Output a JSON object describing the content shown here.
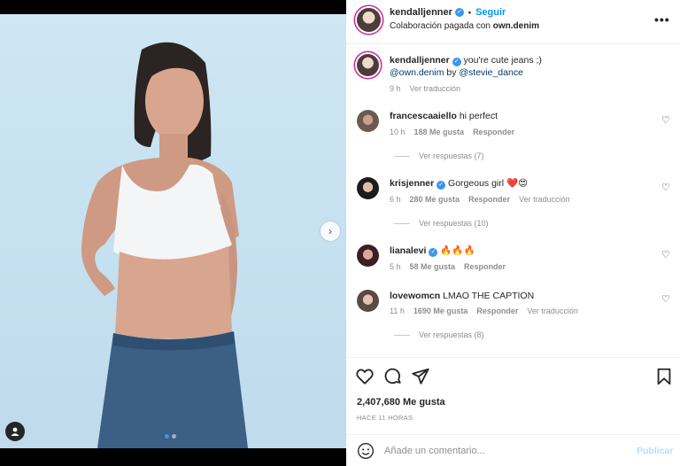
{
  "post": {
    "username": "kendalljenner",
    "follow_label": "Seguir",
    "sponsored_prefix": "Colaboración pagada con",
    "sponsor": "own.denim",
    "caption_text": "you're cute jeans ;)",
    "caption_mention1": "@own.denim",
    "caption_by": "by",
    "caption_mention2": "@stevie_dance",
    "caption_time": "9 h",
    "caption_translate": "Ver traducción",
    "likes": "2,407,680 Me gusta",
    "posted": "HACE 11 HORAS",
    "carousel_pages": 2,
    "carousel_current": 1
  },
  "comments": [
    {
      "user": "francescaaiello",
      "verified": false,
      "text": "hi perfect",
      "time": "10 h",
      "likes": "188 Me gusta",
      "reply": "Responder",
      "translate": "",
      "replies": "Ver respuestas (7)"
    },
    {
      "user": "krisjenner",
      "verified": true,
      "text": "Gorgeous girl ❤️😍",
      "time": "6 h",
      "likes": "280 Me gusta",
      "reply": "Responder",
      "translate": "Ver traducción",
      "replies": "Ver respuestas (10)"
    },
    {
      "user": "lianalevi",
      "verified": true,
      "text": "🔥🔥🔥",
      "time": "5 h",
      "likes": "58 Me gusta",
      "reply": "Responder",
      "translate": "",
      "replies": ""
    },
    {
      "user": "lovewomcn",
      "verified": false,
      "text": "LMAO THE CAPTION",
      "time": "11 h",
      "likes": "1690 Me gusta",
      "reply": "Responder",
      "translate": "Ver traducción",
      "replies": "Ver respuestas (8)"
    }
  ],
  "composer": {
    "placeholder": "Añade un comentario...",
    "post_label": "Publicar"
  },
  "icons": {
    "more": "more-options-icon",
    "like": "heart-icon",
    "comment": "comment-icon",
    "share": "paper-plane-icon",
    "save": "bookmark-icon",
    "emoji": "emoji-icon",
    "next": "chevron-right-icon",
    "tag": "user-tag-icon"
  },
  "colors": {
    "accent": "#0095f6",
    "verified": "#3897f0",
    "muted": "#8e8e8e"
  }
}
